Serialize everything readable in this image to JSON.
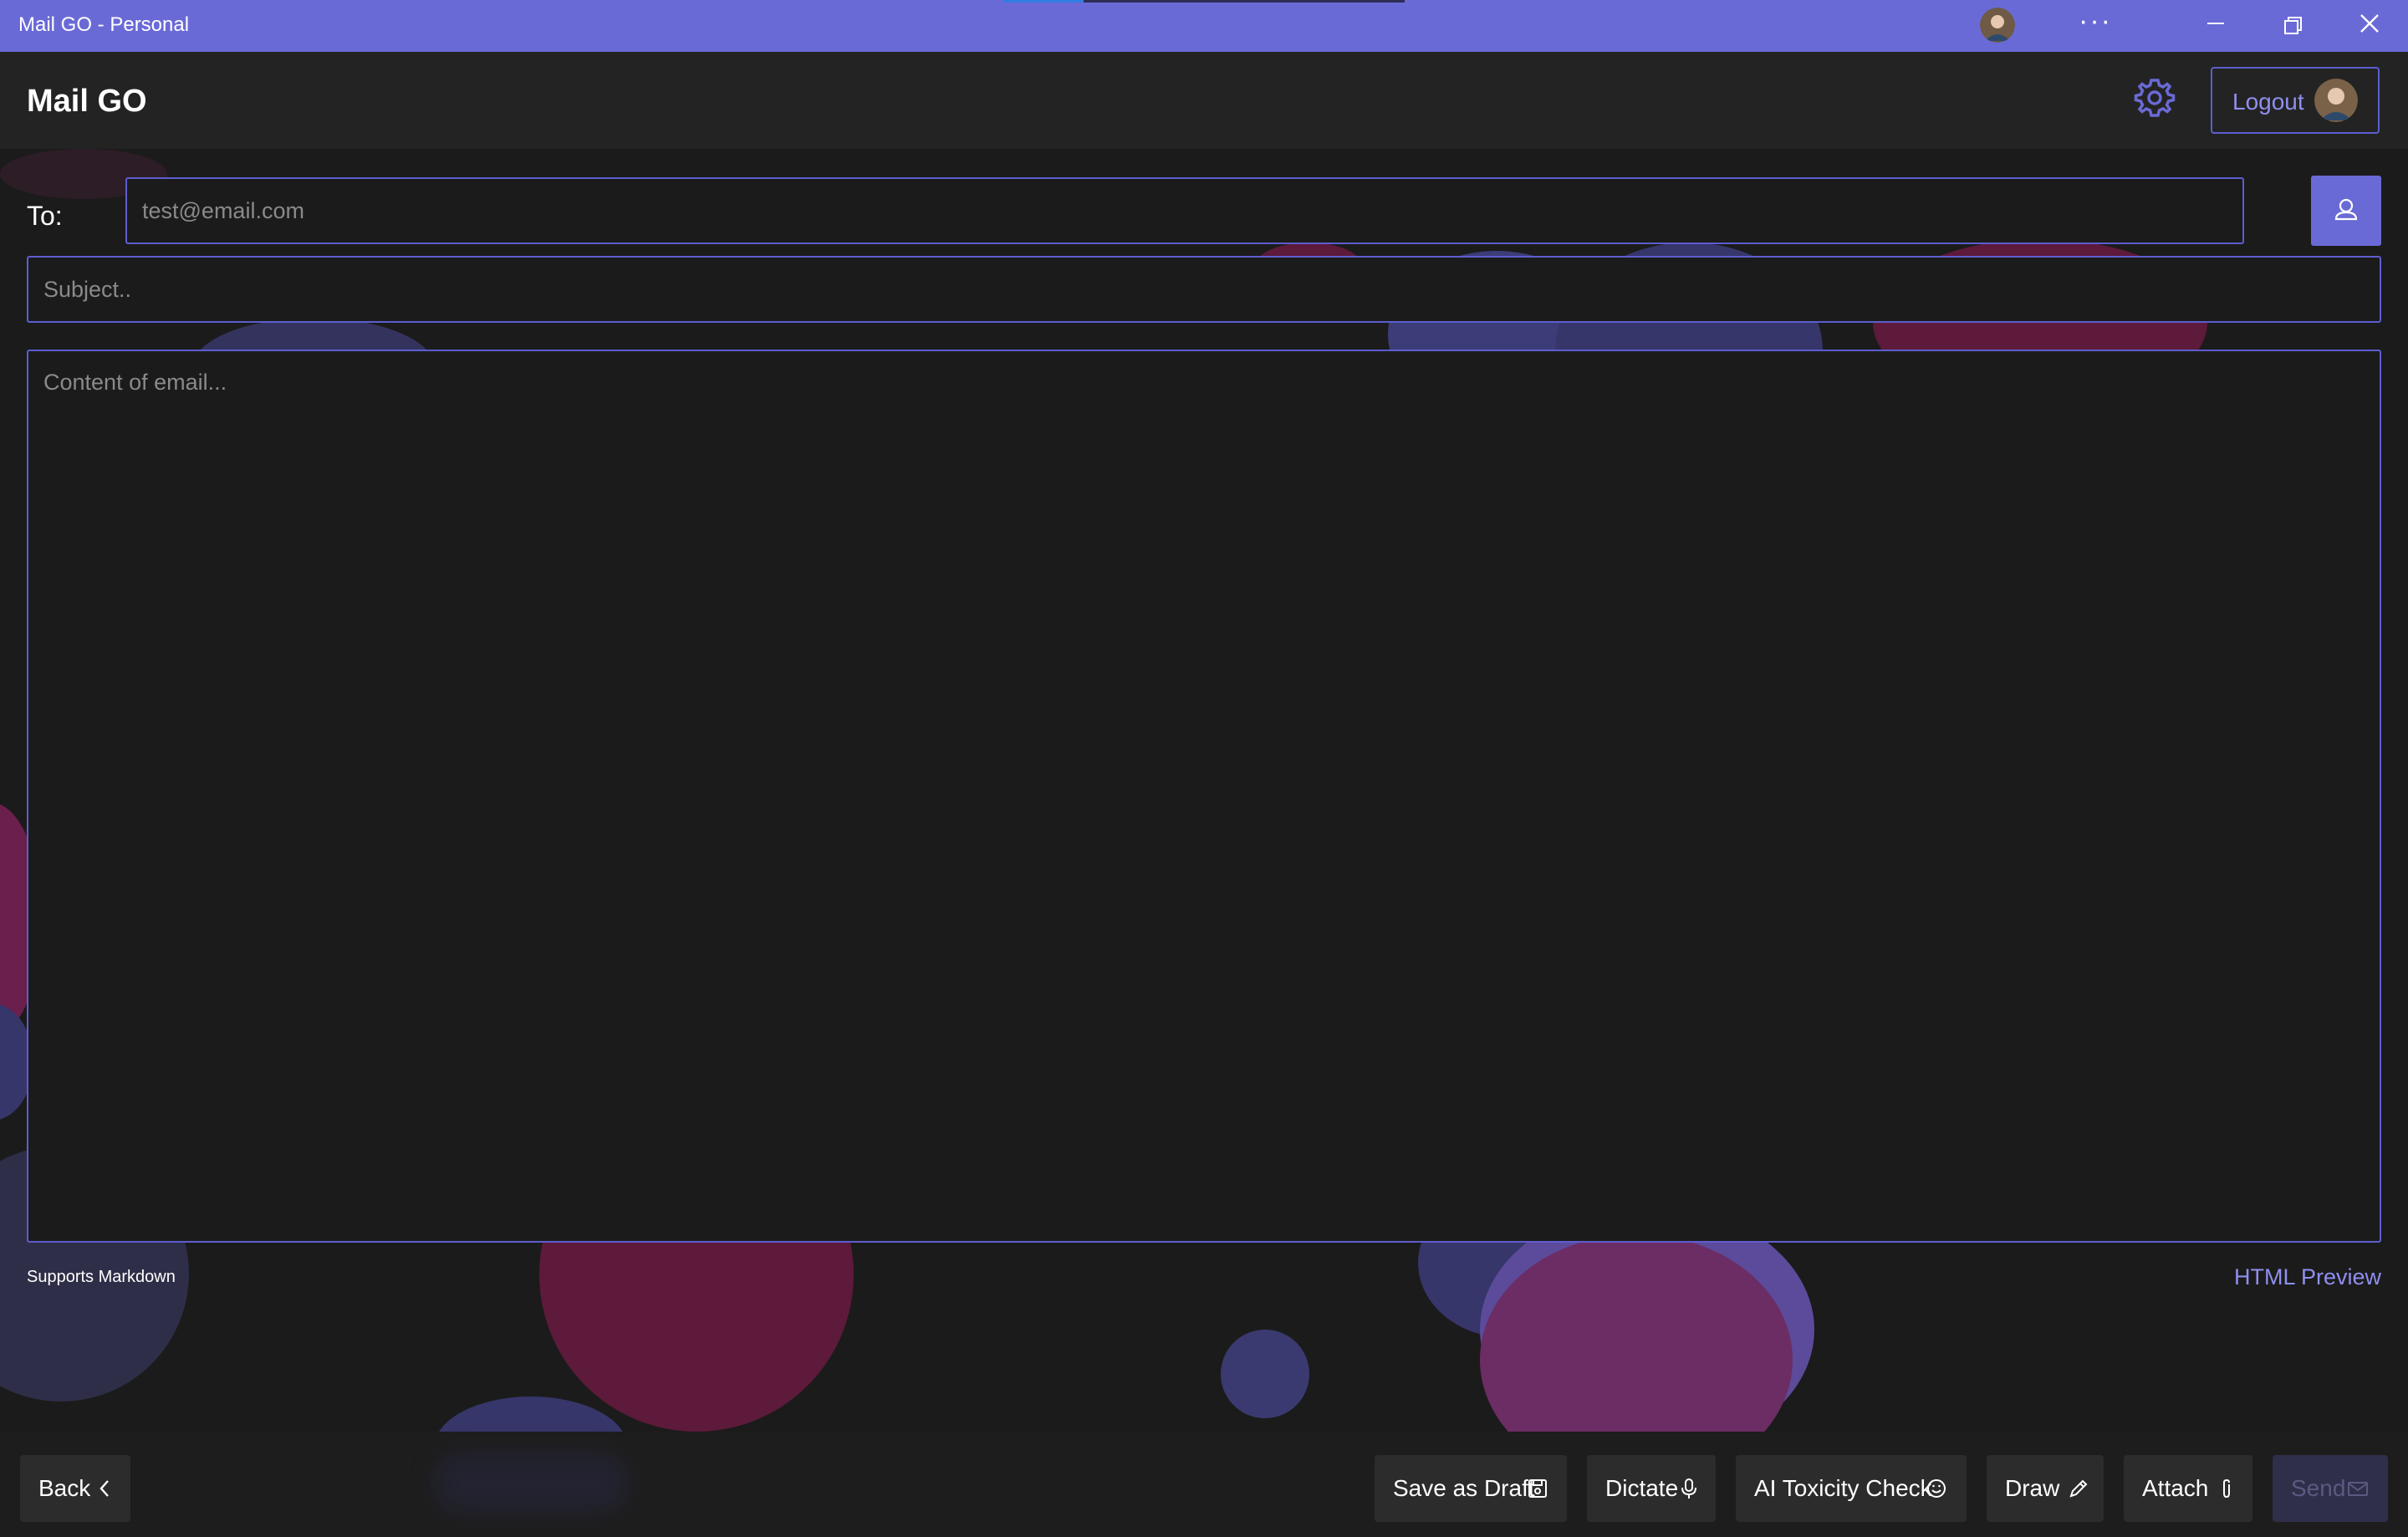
{
  "window": {
    "title": "Mail GO - Personal",
    "loading_progress": 0.2,
    "more_label": "···"
  },
  "header": {
    "app_title": "Mail GO",
    "logout_label": "Logout"
  },
  "compose": {
    "to_label": "To:",
    "to_placeholder": "test@email.com",
    "subject_placeholder": "Subject..",
    "content_placeholder": "Content of email...",
    "markdown_hint": "Supports Markdown",
    "html_preview_label": "HTML Preview"
  },
  "footer": {
    "back_label": "Back",
    "save_draft_label": "Save as Draft",
    "dictate_label": "Dictate",
    "toxicity_label": "AI Toxicity Check",
    "draw_label": "Draw",
    "attach_label": "Attach",
    "send_label": "Send"
  },
  "colors": {
    "accent": "#6a6ad6",
    "background": "#1b1b1b",
    "bubble_red": "#5e1a3a",
    "bubble_blue": "#36366a"
  },
  "icons": [
    "settings-gear-icon",
    "contact-person-icon",
    "chevron-left-icon",
    "save-disk-icon",
    "microphone-icon",
    "smiley-icon",
    "pen-icon",
    "paperclip-icon",
    "mail-icon"
  ]
}
